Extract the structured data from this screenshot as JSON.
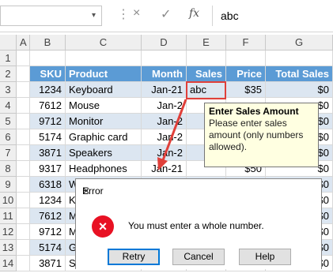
{
  "formula_bar": {
    "name_box": "",
    "cancel_icon": "×",
    "enter_icon": "✓",
    "fx_label": "fx",
    "value": "abc"
  },
  "sheet": {
    "col_headers": [
      "A",
      "B",
      "C",
      "D",
      "E",
      "F",
      "G"
    ],
    "header_row": {
      "sku": "SKU",
      "product": "Product",
      "month": "Month",
      "sales": "Sales",
      "price": "Price",
      "total": "Total Sales"
    },
    "rows": [
      {
        "num": "3",
        "sku": "1234",
        "product": "Keyboard",
        "month": "Jan-21",
        "sales": "abc",
        "price": "$35",
        "total": "$0"
      },
      {
        "num": "4",
        "sku": "7612",
        "product": "Mouse",
        "month": "Jan-2",
        "sales": "",
        "price": "",
        "total": "$0"
      },
      {
        "num": "5",
        "sku": "9712",
        "product": "Monitor",
        "month": "Jan-2",
        "sales": "",
        "price": "",
        "total": "$0"
      },
      {
        "num": "6",
        "sku": "5174",
        "product": "Graphic card",
        "month": "Jan-2",
        "sales": "",
        "price": "",
        "total": "$0"
      },
      {
        "num": "7",
        "sku": "3871",
        "product": "Speakers",
        "month": "Jan-2",
        "sales": "",
        "price": "",
        "total": "$0"
      },
      {
        "num": "8",
        "sku": "9317",
        "product": "Headphones",
        "month": "Jan-21",
        "sales": "",
        "price": "$50",
        "total": "$0"
      },
      {
        "num": "9",
        "sku": "6318",
        "product": "W",
        "month": "",
        "sales": "",
        "price": "",
        "total": "$0"
      },
      {
        "num": "10",
        "sku": "1234",
        "product": "K",
        "month": "",
        "sales": "",
        "price": "",
        "total": "$0"
      },
      {
        "num": "11",
        "sku": "7612",
        "product": "M",
        "month": "",
        "sales": "",
        "price": "",
        "total": "$0"
      },
      {
        "num": "12",
        "sku": "9712",
        "product": "M",
        "month": "",
        "sales": "",
        "price": "",
        "total": "$0"
      },
      {
        "num": "13",
        "sku": "5174",
        "product": "G",
        "month": "",
        "sales": "",
        "price": "",
        "total": "$0"
      },
      {
        "num": "14",
        "sku": "3871",
        "product": "S",
        "month": "",
        "sales": "",
        "price": "",
        "total": "$0"
      }
    ]
  },
  "tooltip": {
    "title": "Enter Sales Amount",
    "message": "Please enter sales amount (only numbers allowed)."
  },
  "dialog": {
    "title": "Error",
    "close": "✕",
    "icon": "×",
    "message": "You must enter a whole number.",
    "retry": "Retry",
    "cancel": "Cancel",
    "help": "Help"
  }
}
